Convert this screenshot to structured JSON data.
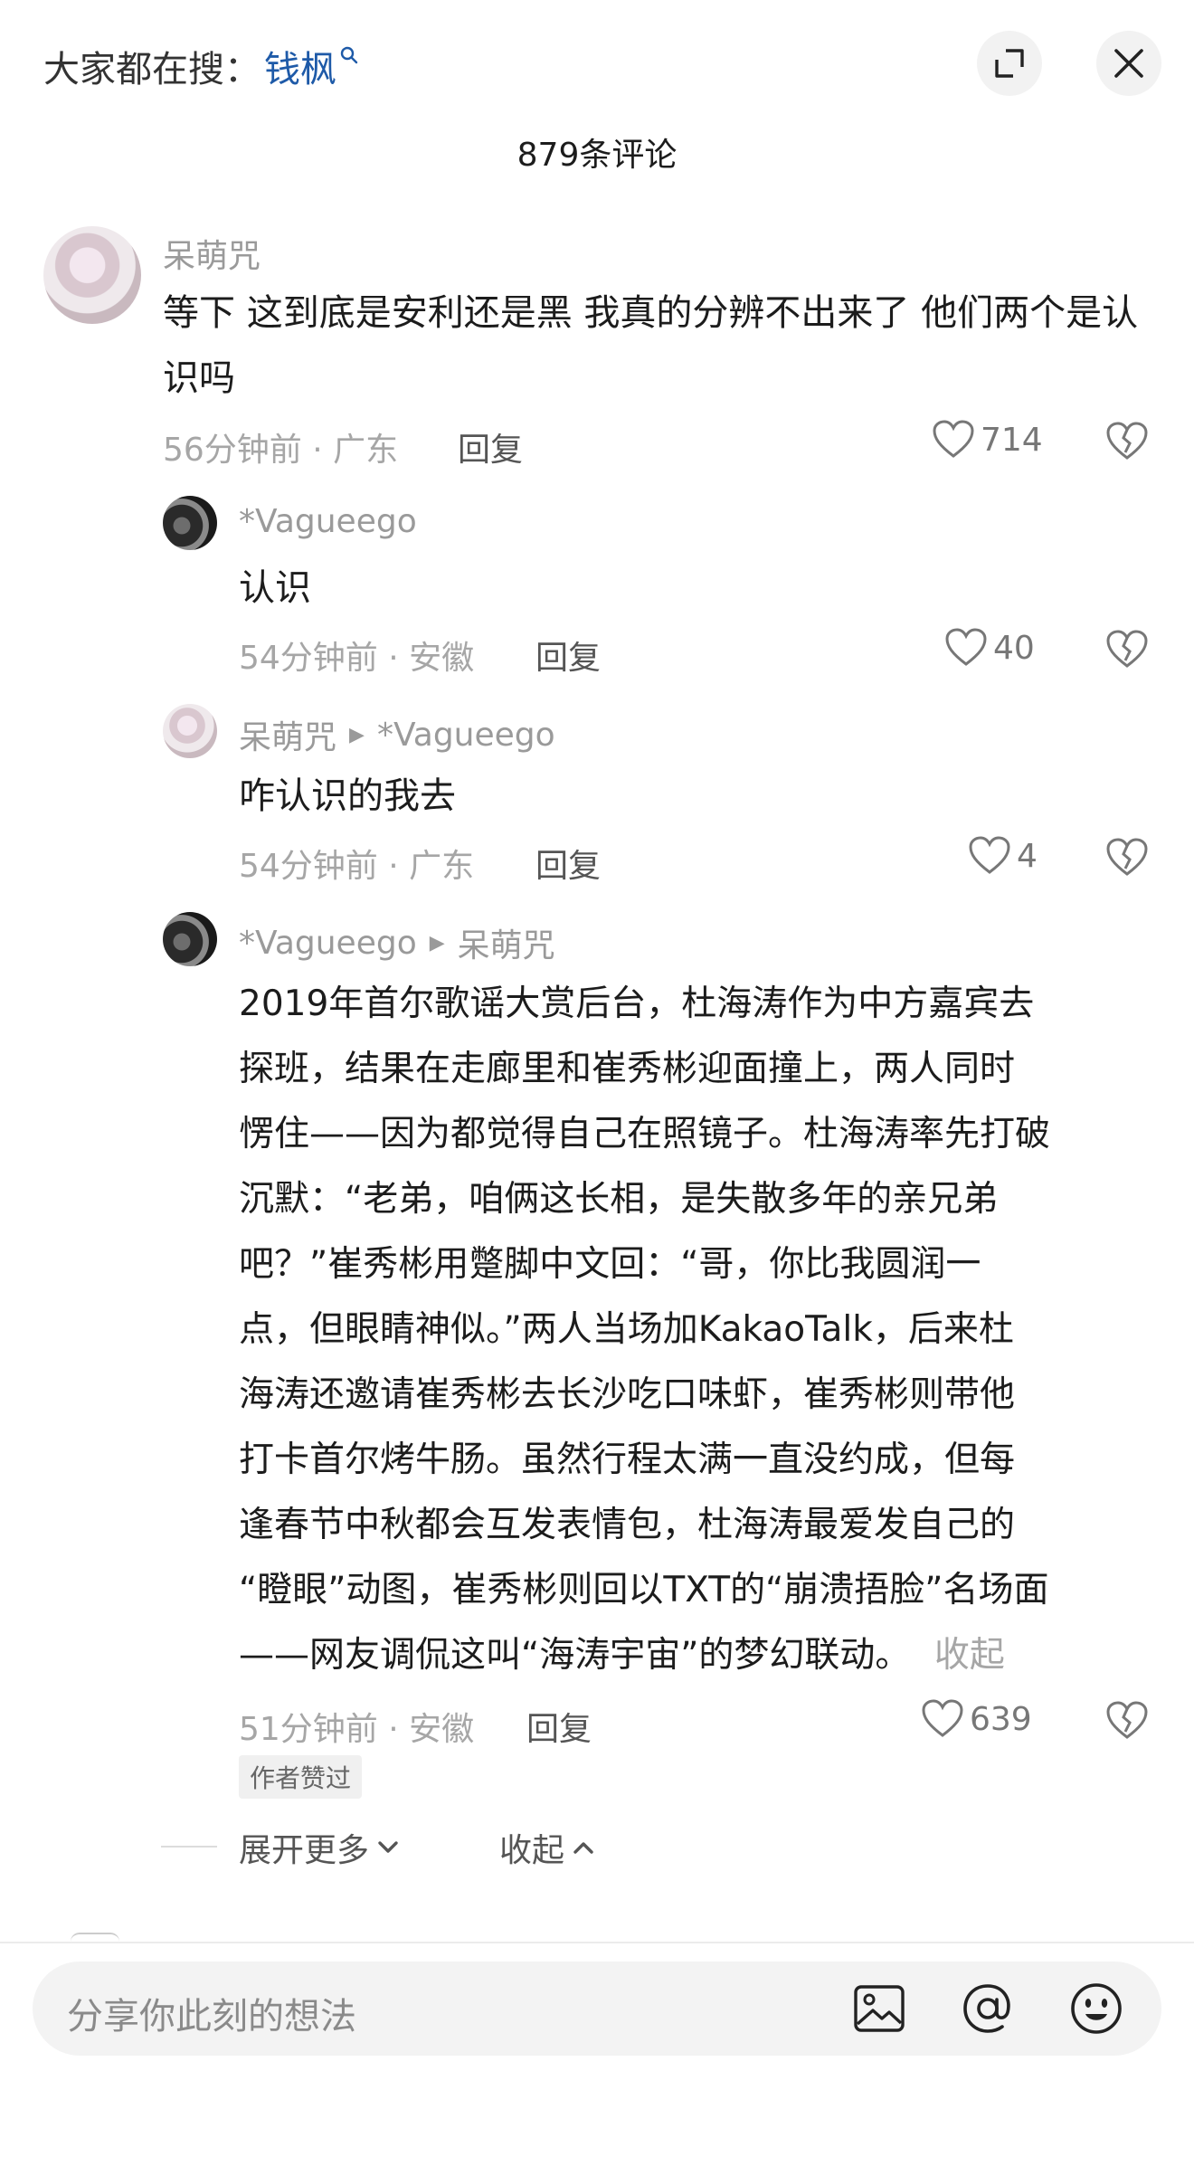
{
  "header": {
    "search_prefix": "大家都在搜：",
    "search_term": "钱枫"
  },
  "comment_count": "879条评论",
  "comments": [
    {
      "user": "呆萌咒",
      "text": "等下 这到底是安利还是黑 我真的分辨不出来了 他们两个是认识吗",
      "meta": "56分钟前 · 广东",
      "reply_label": "回复",
      "likes": "714"
    },
    {
      "user": "*Vagueego",
      "text": "认识",
      "meta": "54分钟前 · 安徽",
      "reply_label": "回复",
      "likes": "40"
    },
    {
      "user": "呆萌咒",
      "reply_to": "*Vagueego",
      "text": "咋认识的我去",
      "meta": "54分钟前 · 广东",
      "reply_label": "回复",
      "likes": "4"
    },
    {
      "user": "*Vagueego",
      "reply_to": "呆萌咒",
      "text_lines": [
        "2019年首尔歌谣大赏后台，杜海涛作为中方嘉宾去",
        "探班，结果在走廊里和崔秀彬迎面撞上，两人同时",
        "愣住——因为都觉得自己在照镜子。杜海涛率先打破",
        "沉默：“老弟，咱俩这长相，是失散多年的亲兄弟",
        "吧？”崔秀彬用蹩脚中文回：“哥，你比我圆润一",
        "点，但眼睛神似。”两人当场加KakaoTalk，后来杜",
        "海涛还邀请崔秀彬去长沙吃口味虾，崔秀彬则带他",
        "打卡首尔烤牛肠。虽然行程太满一直没约成，但每",
        "逢春节中秋都会互发表情包，杜海涛最爱发自己的",
        "“瞪眼”动图，崔秀彬则回以TXT的“崩溃捂脸”名场面",
        "——网友调侃这叫“海涛宇宙”的梦幻联动。"
      ],
      "collapse_label": "收起",
      "meta": "51分钟前 · 安徽",
      "reply_label": "回复",
      "likes": "639",
      "badge": "作者赞过"
    }
  ],
  "thread_controls": {
    "expand_more": "展开更多",
    "collapse": "收起"
  },
  "input": {
    "placeholder": "分享你此刻的想法"
  },
  "icons": [
    "search-icon",
    "expand-icon",
    "close-icon",
    "heart-icon",
    "broken-heart-icon",
    "image-icon",
    "at-icon",
    "emoji-icon",
    "chevron-down-icon",
    "chevron-up-icon",
    "play-arrow-icon"
  ],
  "colors": {
    "link": "#1e5aa8",
    "meta": "#a6a6a6",
    "text": "#1c1c1c"
  }
}
